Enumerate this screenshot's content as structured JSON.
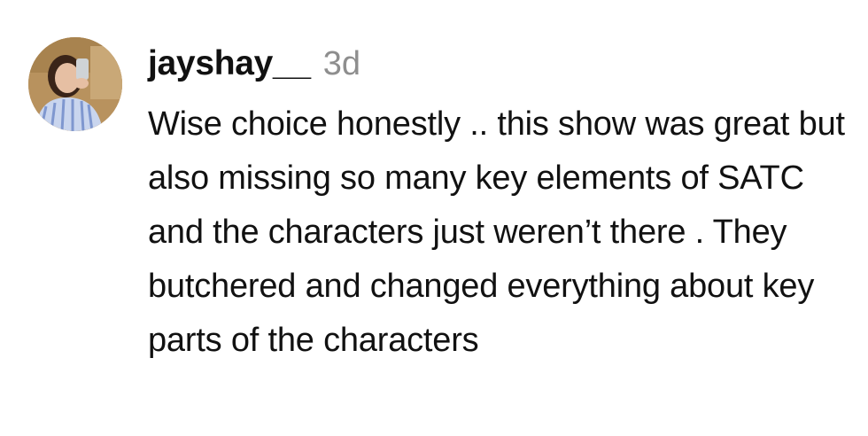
{
  "comment": {
    "username": "jayshay__",
    "timestamp": "3d",
    "text": "Wise choice honestly .. this show was great but also missing so many key elements of SATC and the characters just weren’t there . They butchered and changed everything about key parts of the characters"
  }
}
